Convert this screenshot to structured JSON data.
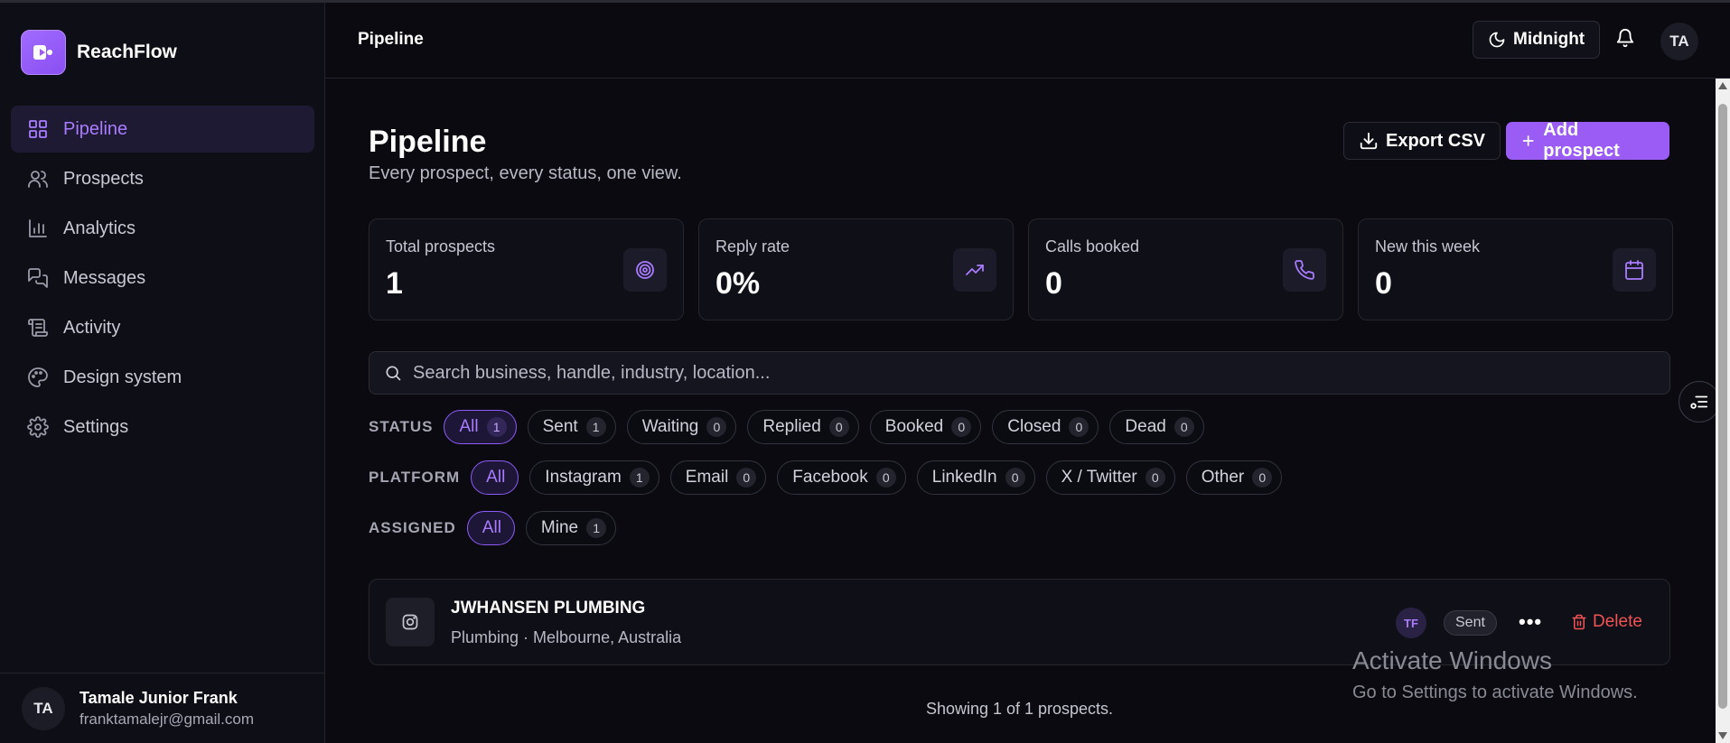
{
  "app": {
    "name": "ReachFlow"
  },
  "sidebar": {
    "items": [
      {
        "label": "Pipeline",
        "icon": "grid-icon",
        "active": true
      },
      {
        "label": "Prospects",
        "icon": "users-icon"
      },
      {
        "label": "Analytics",
        "icon": "bar-chart-icon"
      },
      {
        "label": "Messages",
        "icon": "messages-icon"
      },
      {
        "label": "Activity",
        "icon": "scroll-icon"
      },
      {
        "label": "Design system",
        "icon": "palette-icon"
      },
      {
        "label": "Settings",
        "icon": "gear-icon"
      }
    ],
    "user": {
      "initials": "TA",
      "name": "Tamale Junior Frank",
      "email": "franktamalejr@gmail.com"
    }
  },
  "header": {
    "title": "Pipeline",
    "theme_label": "Midnight",
    "avatar_initials": "TA"
  },
  "main": {
    "title": "Pipeline",
    "subtitle": "Every prospect, every status, one view.",
    "export_label": "Export CSV",
    "add_label": "Add prospect",
    "stats": [
      {
        "label": "Total prospects",
        "value": "1",
        "icon": "target-icon"
      },
      {
        "label": "Reply rate",
        "value": "0%",
        "icon": "trending-up-icon"
      },
      {
        "label": "Calls booked",
        "value": "0",
        "icon": "phone-icon"
      },
      {
        "label": "New this week",
        "value": "0",
        "icon": "calendar-icon"
      }
    ],
    "search": {
      "placeholder": "Search business, handle, industry, location...",
      "value": ""
    },
    "filters": {
      "status": {
        "label": "STATUS",
        "chips": [
          {
            "label": "All",
            "count": "1",
            "active": true
          },
          {
            "label": "Sent",
            "count": "1"
          },
          {
            "label": "Waiting",
            "count": "0"
          },
          {
            "label": "Replied",
            "count": "0"
          },
          {
            "label": "Booked",
            "count": "0"
          },
          {
            "label": "Closed",
            "count": "0"
          },
          {
            "label": "Dead",
            "count": "0"
          }
        ]
      },
      "platform": {
        "label": "PLATFORM",
        "chips": [
          {
            "label": "All",
            "count": "",
            "active": true
          },
          {
            "label": "Instagram",
            "count": "1"
          },
          {
            "label": "Email",
            "count": "0"
          },
          {
            "label": "Facebook",
            "count": "0"
          },
          {
            "label": "LinkedIn",
            "count": "0"
          },
          {
            "label": "X / Twitter",
            "count": "0"
          },
          {
            "label": "Other",
            "count": "0"
          }
        ]
      },
      "assigned": {
        "label": "ASSIGNED",
        "chips": [
          {
            "label": "All",
            "count": "",
            "active": true
          },
          {
            "label": "Mine",
            "count": "1"
          }
        ]
      }
    },
    "prospects": [
      {
        "name": "JWHANSEN PLUMBING",
        "meta": "Plumbing · Melbourne, Australia",
        "platform_icon": "instagram-icon",
        "assignee": "TF",
        "status": "Sent",
        "delete_label": "Delete"
      }
    ],
    "showing": "Showing 1 of 1 prospects."
  },
  "watermark": {
    "line1": "Activate Windows",
    "line2": "Go to Settings to activate Windows."
  },
  "colors": {
    "accent": "#9b5cf6",
    "background": "#0a0a10",
    "danger": "#f05454"
  }
}
